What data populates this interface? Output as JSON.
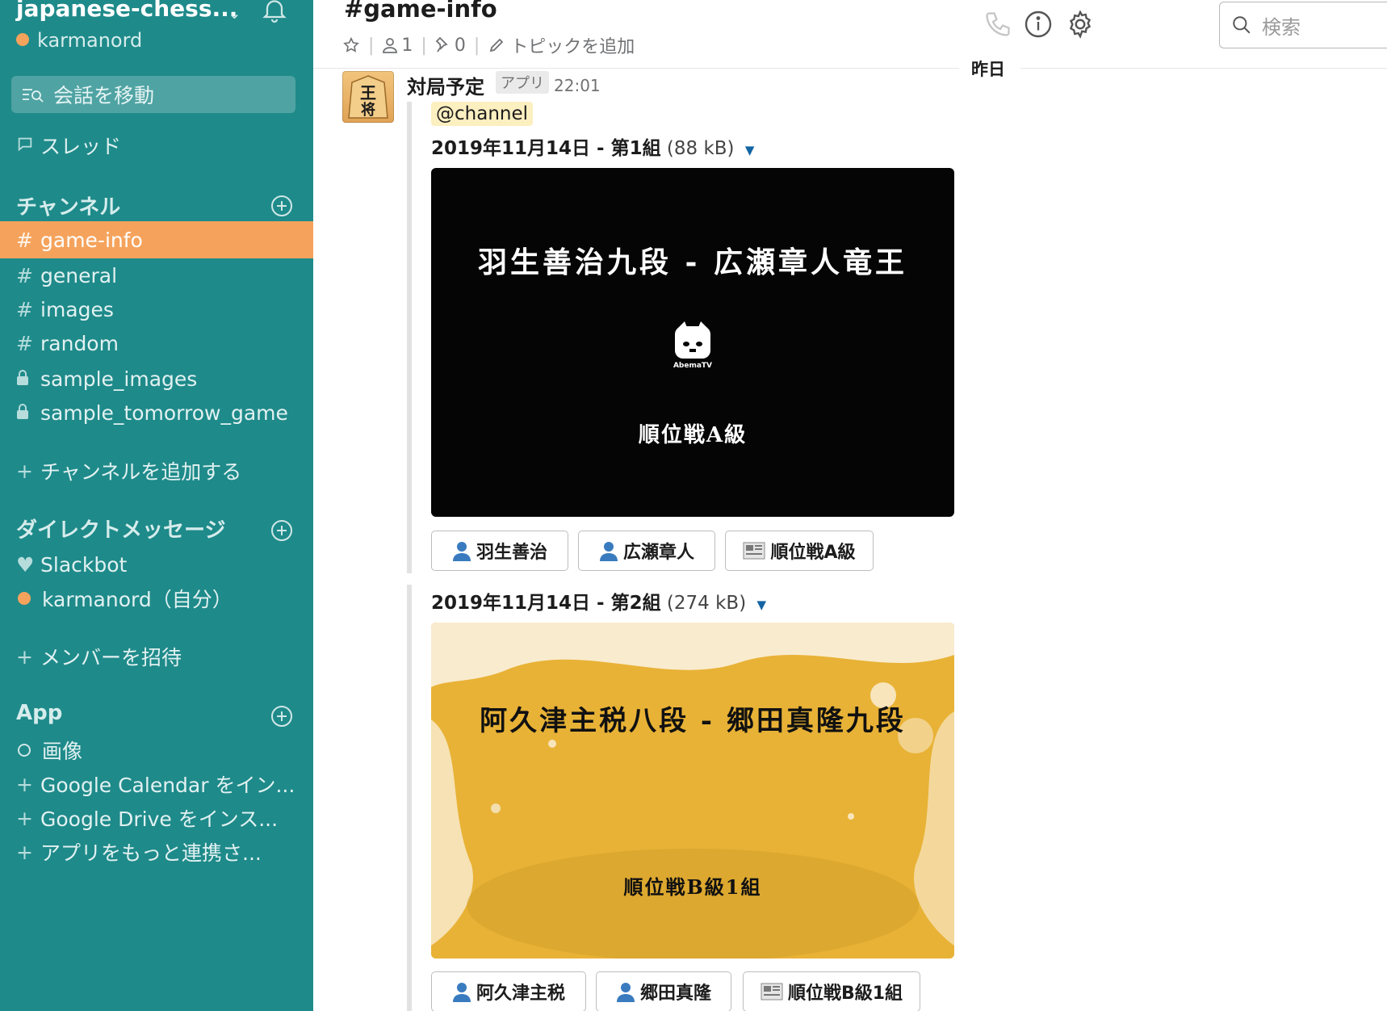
{
  "workspace": {
    "name": "japanese-chess...",
    "user": "karmanord"
  },
  "sidebar": {
    "jump_label": "会話を移動",
    "threads_label": "スレッド",
    "channels_title": "チャンネル",
    "channels": [
      {
        "prefix": "#",
        "name": "game-info"
      },
      {
        "prefix": "#",
        "name": "general"
      },
      {
        "prefix": "#",
        "name": "images"
      },
      {
        "prefix": "#",
        "name": "random"
      },
      {
        "prefix": "lock",
        "name": "sample_images"
      },
      {
        "prefix": "lock",
        "name": "sample_tomorrow_game"
      }
    ],
    "add_channel": "チャンネルを追加する",
    "dm_title": "ダイレクトメッセージ",
    "dms": [
      {
        "name": "Slackbot"
      },
      {
        "name": "karmanord（自分）"
      }
    ],
    "invite": "メンバーを招待",
    "app_title": "App",
    "apps": [
      {
        "name": "画像"
      },
      {
        "name": "Google Calendar をイン..."
      },
      {
        "name": "Google Drive をインス..."
      },
      {
        "name": "アプリをもっと連携さ..."
      }
    ],
    "plus": "+",
    "active_color": "#f5a35c",
    "bg_color": "#1f8a8a"
  },
  "header": {
    "title": "#game-info",
    "members": "1",
    "pins": "0",
    "add_topic": "トピックを追加",
    "search_placeholder": "検索"
  },
  "day_divider": "昨日",
  "message": {
    "author": "対局予定",
    "badge": "アプリ",
    "time": "22:01",
    "mention": "@channel",
    "avatar_text": "王将",
    "files": [
      {
        "title_bold": "2019年11月14日 - 第1組",
        "size": "(88 kB)",
        "players_line": "羽生善治九段 - 広瀬章人竜王",
        "league_line": "順位戦A級",
        "logo_text": "AbemaTV",
        "buttons": [
          "羽生善治",
          "広瀬章人",
          "順位戦A級"
        ]
      },
      {
        "title_bold": "2019年11月14日 - 第2組",
        "size": "(274 kB)",
        "players_line": "阿久津主税八段 - 郷田真隆九段",
        "league_line": "順位戦B級1組",
        "buttons": [
          "阿久津主税",
          "郷田真隆",
          "順位戦B級1組"
        ]
      }
    ]
  }
}
